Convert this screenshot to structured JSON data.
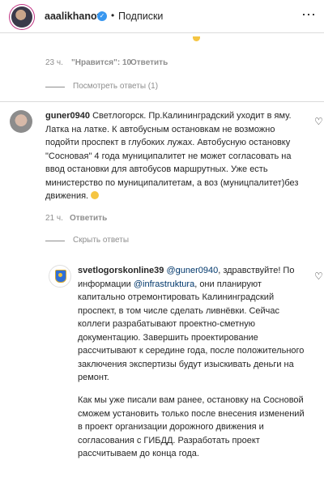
{
  "header": {
    "username": "aaalikhanov",
    "verified_glyph": "✓",
    "separator": "•",
    "follow_label": "Подписки",
    "more_glyph": "⋯"
  },
  "previous_comment": {
    "time": "23 ч.",
    "likes": "\"Нравится\": 10",
    "reply_label": "Ответить",
    "view_replies_label": "Посмотреть ответы (1)"
  },
  "comment": {
    "username": "guner0940",
    "text": " Светлогорск. Пр.Калининградский уходит в яму. Латка на латке. К автобусным остановкам не возможно подойти проспект в глубоких лужах. Автобусную остановку \"Сосновая\" 4 года муниципалитет не может согласовать на ввод остановки для автобусов маршрутных. Уже есть министерство по муниципалитетам, а воз (муницпалитет)без движения.",
    "time": "21 ч.",
    "reply_label": "Ответить",
    "hide_replies_label": "Скрыть ответы",
    "heart_glyph": "♡"
  },
  "reply": {
    "username": "svetlogorskonline39",
    "mention_user": "@guner0940",
    "text_part1": ", здравствуйте! По информации ",
    "mention_org": "@infrastruktura",
    "text_part2": ", они планируют капитально отремонтировать Калининградский проспект, в том числе сделать ливнёвки. Сейчас коллеги разрабатывают проектно-сметную документацию. Завершить проектирование рассчитывают к середине года, после положительного заключения экспертизы будут изыскивать деньги на ремонт.",
    "paragraph2": "Как мы уже писали вам ранее, остановку на Сосновой сможем установить только после внесения изменений в проект организации дорожного движения и согласования с ГИБДД. Разработать проект рассчитываем до конца года.",
    "heart_glyph": "♡"
  }
}
